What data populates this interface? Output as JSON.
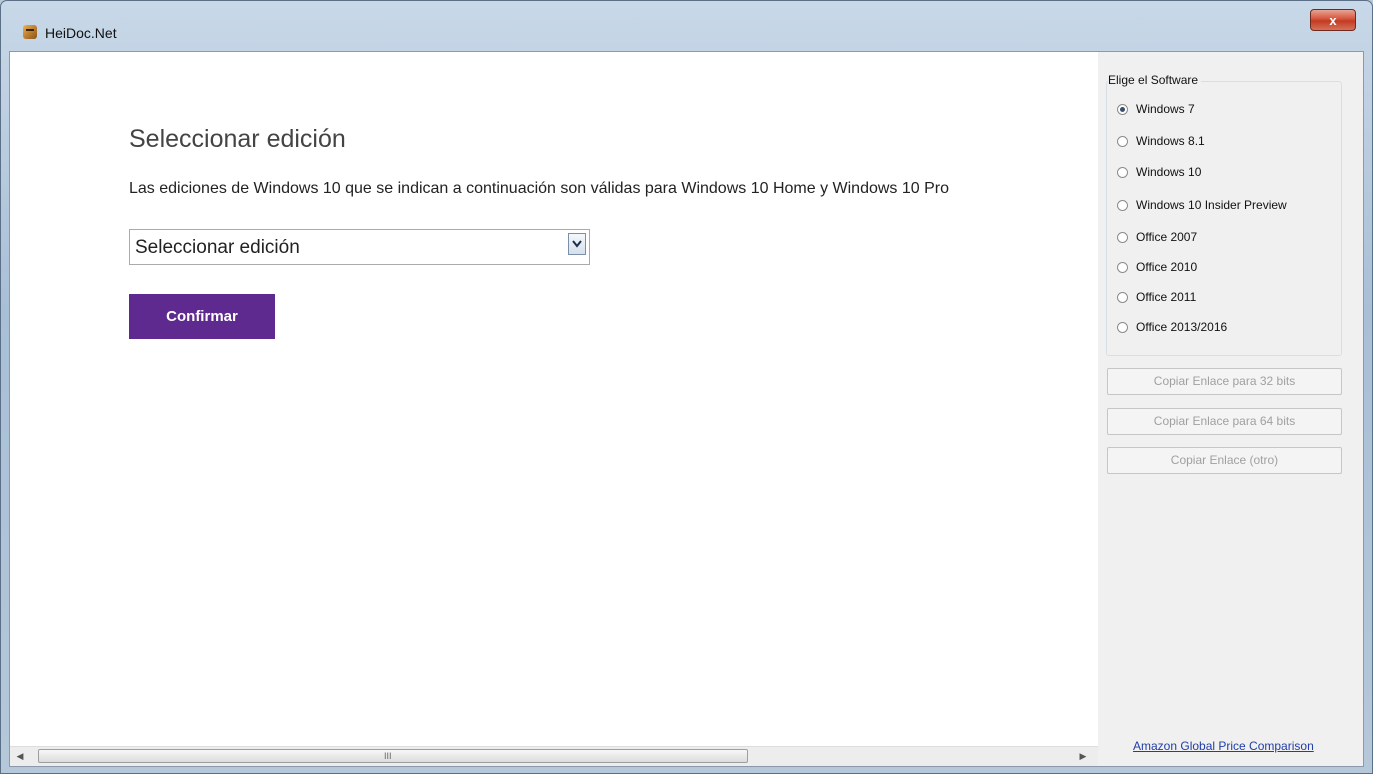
{
  "window": {
    "title": "HeiDoc.Net",
    "close_label": "x"
  },
  "main": {
    "page_title": "Seleccionar edición",
    "description": "Las ediciones de Windows 10 que se indican a continuación son válidas para Windows 10 Home y Windows 10 Pro",
    "edition_select": {
      "value": "Seleccionar edición"
    },
    "confirm_label": "Confirmar",
    "scrollbar": {
      "left_arrow": "◀",
      "right_arrow": "▶",
      "grip": "III"
    }
  },
  "sidebar": {
    "group_label": "Elige el Software",
    "options": [
      {
        "label": "Windows 7",
        "checked": true
      },
      {
        "label": "Windows 8.1",
        "checked": false
      },
      {
        "label": "Windows 10",
        "checked": false
      },
      {
        "label": "Windows 10 Insider Preview",
        "checked": false
      },
      {
        "label": "Office 2007",
        "checked": false
      },
      {
        "label": "Office 2010",
        "checked": false
      },
      {
        "label": "Office 2011",
        "checked": false
      },
      {
        "label": "Office 2013/2016",
        "checked": false
      }
    ],
    "buttons": [
      {
        "label": "Copiar Enlace para 32 bits"
      },
      {
        "label": "Copiar Enlace para 64 bits"
      },
      {
        "label": "Copiar Enlace (otro)"
      }
    ],
    "link": "Amazon Global Price Comparison"
  },
  "colors": {
    "confirm_bg": "#5e2a8f",
    "link": "#1f3ea8",
    "close": "#c23b22"
  }
}
